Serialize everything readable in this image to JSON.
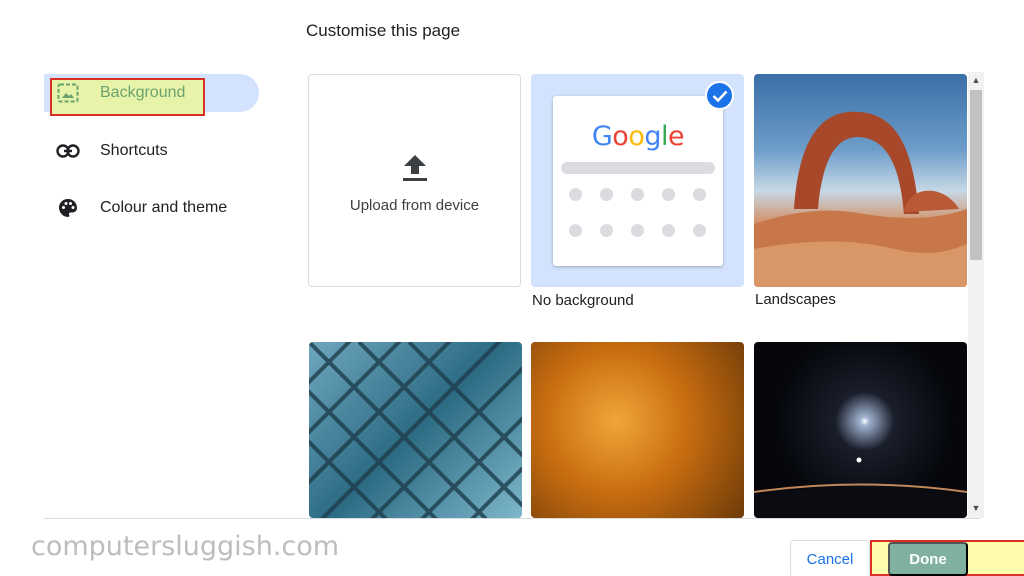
{
  "dialog": {
    "title": "Customise this page"
  },
  "sidebar": {
    "items": [
      {
        "label": "Background",
        "icon": "image-icon",
        "active": true
      },
      {
        "label": "Shortcuts",
        "icon": "link-icon",
        "active": false
      },
      {
        "label": "Colour and theme",
        "icon": "palette-icon",
        "active": false
      }
    ]
  },
  "grid": {
    "upload": {
      "label": "Upload from device",
      "icon": "upload-icon"
    },
    "no_background": {
      "label": "No background",
      "logo": "Google",
      "selected": true
    },
    "collections": [
      {
        "label": "Landscapes"
      },
      {
        "label": ""
      },
      {
        "label": ""
      },
      {
        "label": ""
      }
    ]
  },
  "footer": {
    "cancel_label": "Cancel",
    "done_label": "Done"
  },
  "watermark": "computersluggish.com",
  "colors": {
    "accent": "#1a73e8",
    "active_item_bg": "#d3e3fd",
    "highlight_box": "#d93025"
  }
}
